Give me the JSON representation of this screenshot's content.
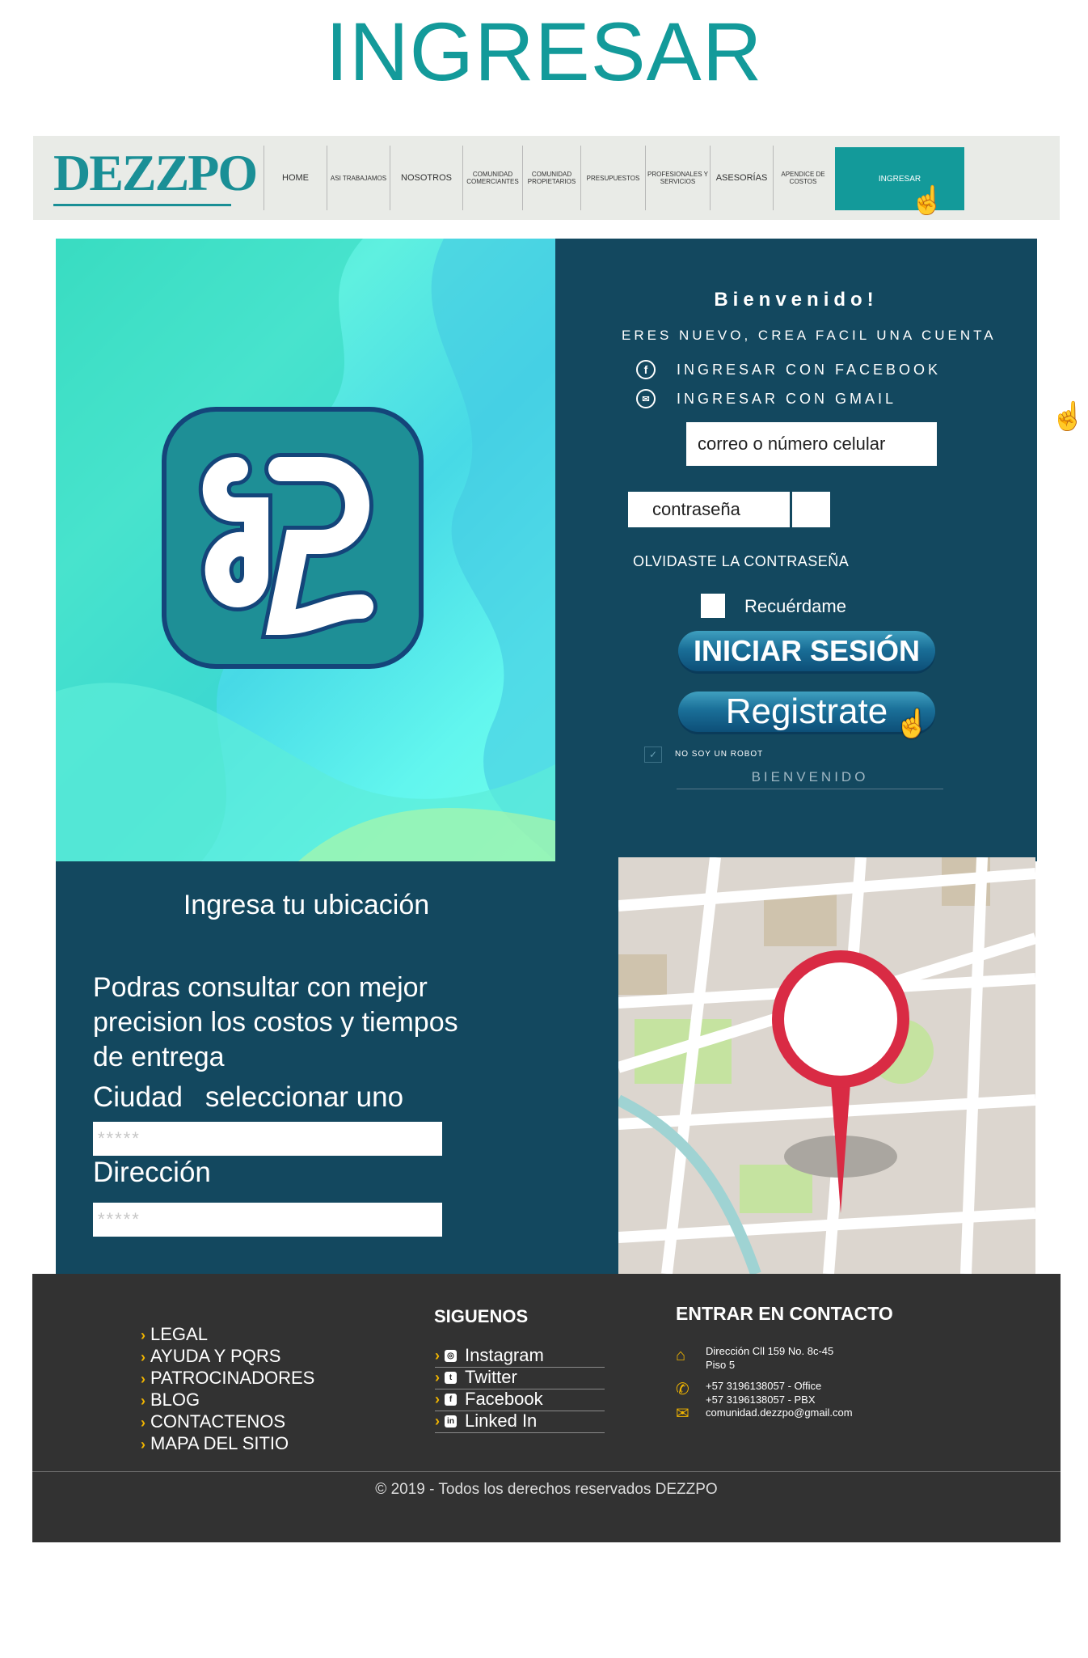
{
  "page_title": "INGRESAR",
  "navbar": {
    "logo": "DEZZPO",
    "items": [
      {
        "label": "HOME"
      },
      {
        "label": "ASI TRABAJAMOS"
      },
      {
        "label": "NOSOTROS"
      },
      {
        "label": "COMUNIDAD COMERCIANTES"
      },
      {
        "label": "COMUNIDAD PROPIETARIOS"
      },
      {
        "label": "PRESUPUESTOS"
      },
      {
        "label": "PROFESIONALES Y SERVICIOS"
      },
      {
        "label": "ASESORÍAS"
      },
      {
        "label": "APENDICE DE COSTOS"
      },
      {
        "label": "INGRESAR"
      }
    ],
    "active": "INGRESAR"
  },
  "login": {
    "welcome": "Bienvenido!",
    "new_account": "ERES NUEVO, CREA FACIL UNA CUENTA",
    "facebook_label": "INGRESAR CON FACEBOOK",
    "gmail_label": "INGRESAR CON GMAIL",
    "email_placeholder": "correo o número celular",
    "password_placeholder": "contraseña",
    "forgot": "OLVIDASTE LA CONTRASEÑA",
    "remember": "Recuérdame",
    "login_button": "INICIAR SESIÓN",
    "register_button": "Registrate",
    "captcha": "NO SOY UN ROBOT",
    "bienvenido": "BIENVENIDO"
  },
  "location": {
    "title": "Ingresa tu ubicación",
    "description": "Podras consultar con mejor precision los costos y tiempos de entrega",
    "city_label": "Ciudad",
    "city_select": "seleccionar uno",
    "city_input_placeholder": "*****",
    "address_label": "Dirección",
    "address_input_placeholder": "*****"
  },
  "footer": {
    "links": [
      "LEGAL",
      "AYUDA Y PQRS",
      "PATROCINADORES",
      "BLOG",
      "CONTACTENOS",
      "MAPA DEL SITIO"
    ],
    "social_title": "SIGUENOS",
    "social": [
      "Instagram",
      "Twitter",
      "Facebook",
      "Linked In"
    ],
    "contact_title": "ENTRAR EN CONTACTO",
    "address_line1": "Dirección  Cll 159 No. 8c-45",
    "address_line2": "Piso 5",
    "phone_line1": "+57 3196138057 - Office",
    "phone_line2": "+57 3196138057 - PBX",
    "email": "comunidad.dezzpo@gmail.com",
    "copyright": "© 2019 - Todos los derechos reservados DEZZPO"
  },
  "colors": {
    "brand_teal": "#139a9a",
    "panel_navy": "#13485f",
    "footer_dark": "#323232",
    "accent_yellow": "#f0b400"
  }
}
